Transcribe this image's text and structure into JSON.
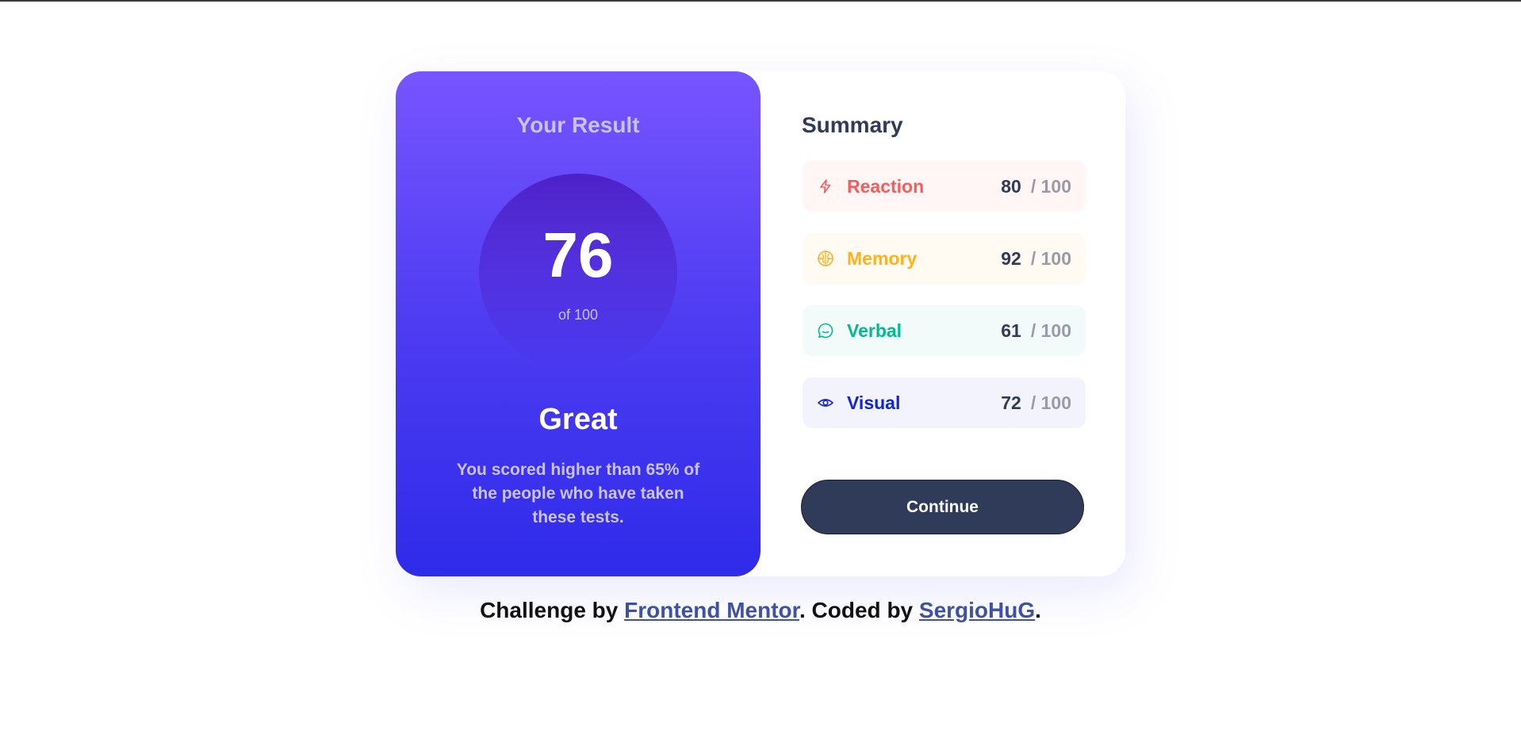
{
  "result": {
    "title": "Your Result",
    "score": "76",
    "of_text": "of 100",
    "rating": "Great",
    "description": "You scored higher than 65% of the people who have taken these tests."
  },
  "summary": {
    "title": "Summary",
    "items": [
      {
        "label": "Reaction",
        "score": "80",
        "max": "/ 100",
        "icon": "lightning-icon",
        "color": "#f55c5c",
        "bg": "#fff6f5"
      },
      {
        "label": "Memory",
        "score": "92",
        "max": "/ 100",
        "icon": "brain-icon",
        "color": "#ffb21e",
        "bg": "#fffbf3"
      },
      {
        "label": "Verbal",
        "score": "61",
        "max": "/ 100",
        "icon": "chat-bubble-icon",
        "color": "#00bb8f",
        "bg": "#f2fbf9"
      },
      {
        "label": "Visual",
        "score": "72",
        "max": "/ 100",
        "icon": "eye-icon",
        "color": "#1125d6",
        "bg": "#f3f3fd"
      }
    ],
    "continue_label": "Continue"
  },
  "footer": {
    "prefix": "Challenge by ",
    "link1": "Frontend Mentor",
    "middle": ". Coded by ",
    "link2": "SergioHuG",
    "suffix": "."
  }
}
